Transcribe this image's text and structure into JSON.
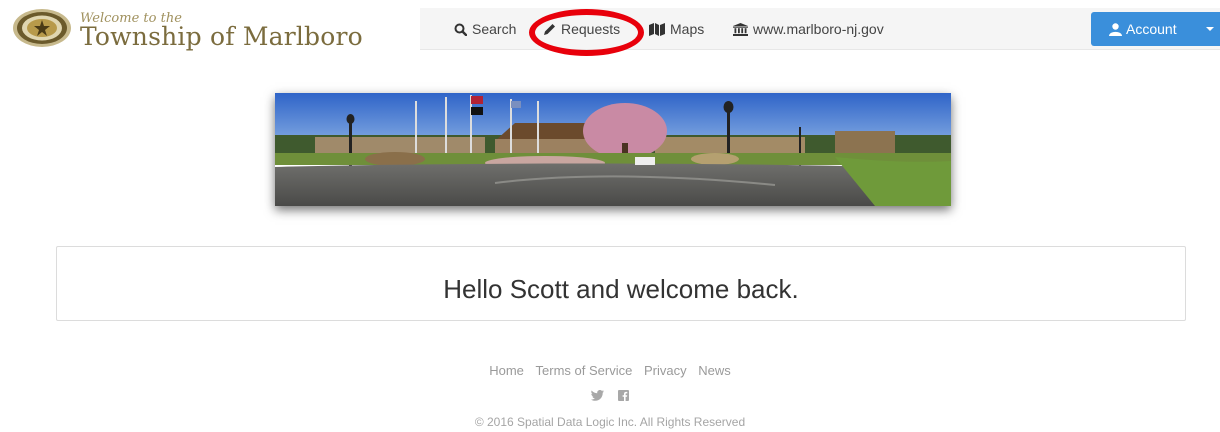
{
  "brand": {
    "tagline": "Welcome to the",
    "name": "Township of Marlboro"
  },
  "nav": {
    "items": [
      {
        "label": "Search",
        "icon": "search-icon"
      },
      {
        "label": "Requests",
        "icon": "pencil-icon"
      },
      {
        "label": "Maps",
        "icon": "map-icon"
      },
      {
        "label": "www.marlboro-nj.gov",
        "icon": "bank-icon"
      }
    ],
    "account_label": "Account"
  },
  "main": {
    "welcome": "Hello Scott and welcome back."
  },
  "footer": {
    "links": [
      "Home",
      "Terms of Service",
      "Privacy",
      "News"
    ],
    "social": [
      "twitter-icon",
      "facebook-icon"
    ],
    "copyright": "© 2016 Spatial Data Logic Inc. All Rights Reserved"
  },
  "colors": {
    "accent": "#3a8fdb",
    "brand_text": "#7b6c3e",
    "highlight": "#e8000b",
    "navbar_bg": "#f5f5f5"
  }
}
